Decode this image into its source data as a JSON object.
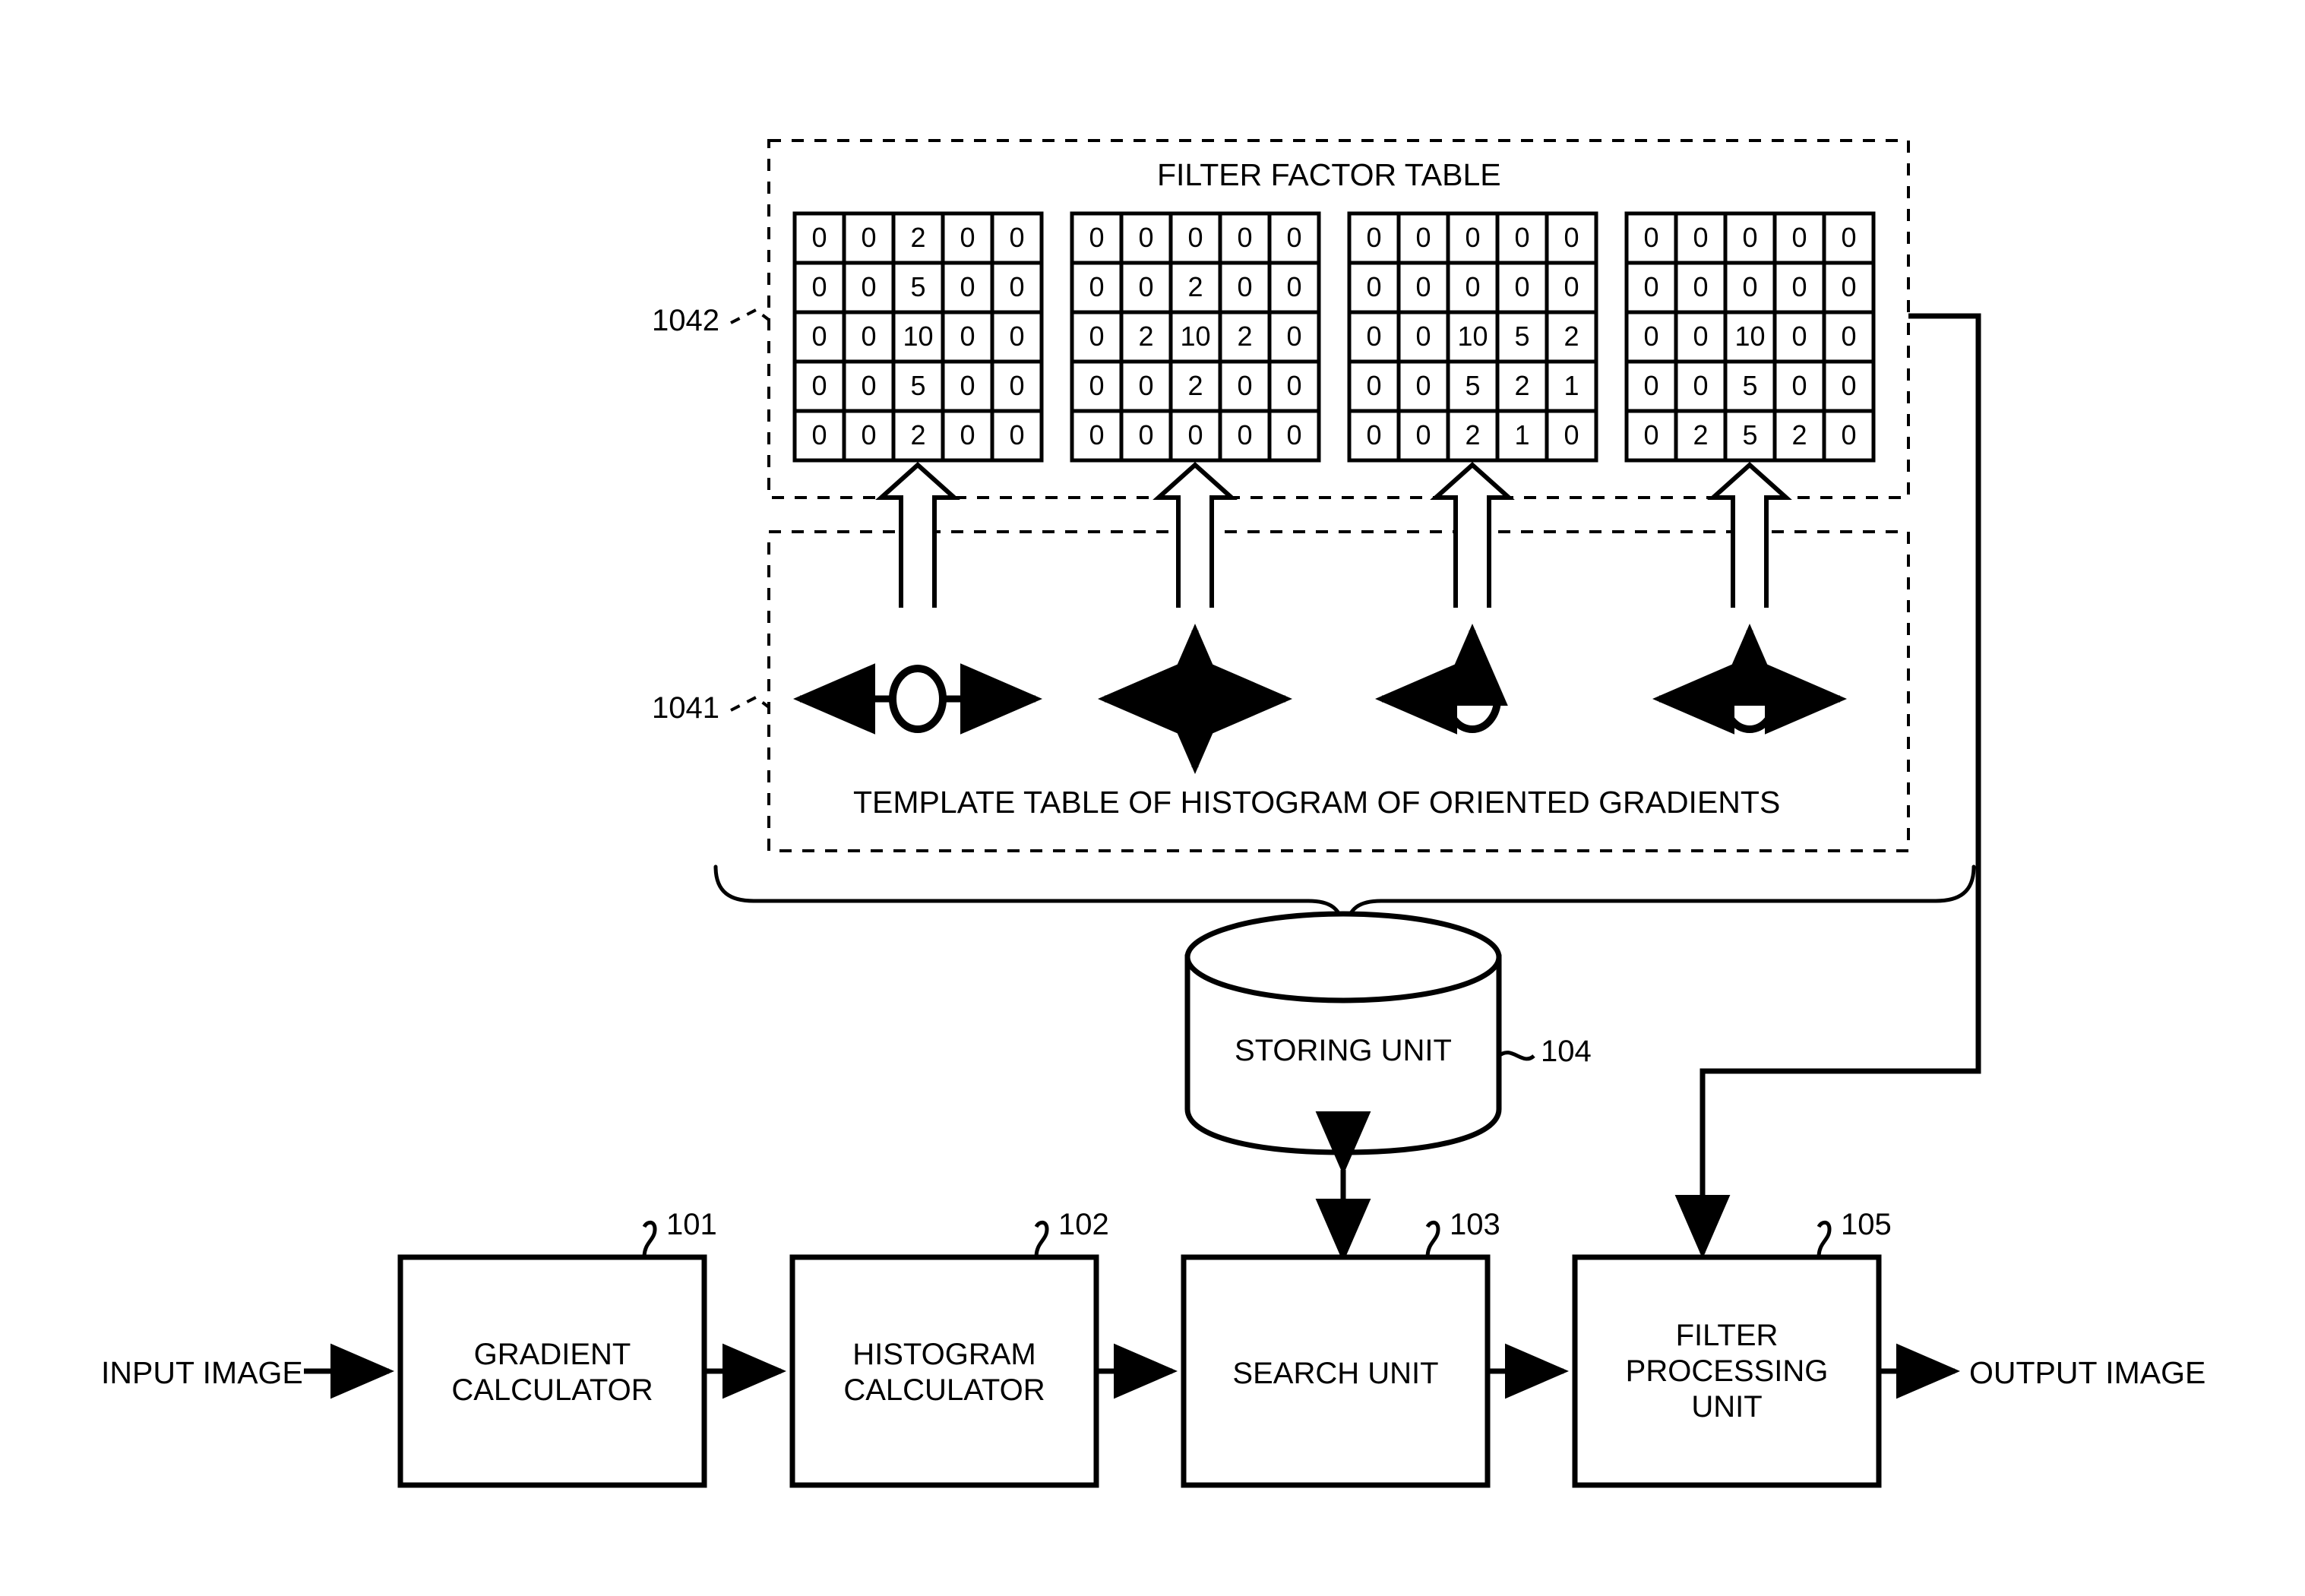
{
  "figure": {
    "filter_factor_table": {
      "title": "FILTER FACTOR TABLE",
      "ref": "1042",
      "matrices": [
        {
          "name": "matrix-1",
          "rows": [
            [
              "0",
              "0",
              "2",
              "0",
              "0"
            ],
            [
              "0",
              "0",
              "5",
              "0",
              "0"
            ],
            [
              "0",
              "0",
              "10",
              "0",
              "0"
            ],
            [
              "0",
              "0",
              "5",
              "0",
              "0"
            ],
            [
              "0",
              "0",
              "2",
              "0",
              "0"
            ]
          ]
        },
        {
          "name": "matrix-2",
          "rows": [
            [
              "0",
              "0",
              "0",
              "0",
              "0"
            ],
            [
              "0",
              "0",
              "2",
              "0",
              "0"
            ],
            [
              "0",
              "2",
              "10",
              "2",
              "0"
            ],
            [
              "0",
              "0",
              "2",
              "0",
              "0"
            ],
            [
              "0",
              "0",
              "0",
              "0",
              "0"
            ]
          ]
        },
        {
          "name": "matrix-3",
          "rows": [
            [
              "0",
              "0",
              "0",
              "0",
              "0"
            ],
            [
              "0",
              "0",
              "0",
              "0",
              "0"
            ],
            [
              "0",
              "0",
              "10",
              "5",
              "2"
            ],
            [
              "0",
              "0",
              "5",
              "2",
              "1"
            ],
            [
              "0",
              "0",
              "2",
              "1",
              "0"
            ]
          ]
        },
        {
          "name": "matrix-4",
          "rows": [
            [
              "0",
              "0",
              "0",
              "0",
              "0"
            ],
            [
              "0",
              "0",
              "0",
              "0",
              "0"
            ],
            [
              "0",
              "0",
              "10",
              "0",
              "0"
            ],
            [
              "0",
              "0",
              "5",
              "0",
              "0"
            ],
            [
              "0",
              "2",
              "5",
              "2",
              "0"
            ]
          ]
        }
      ]
    },
    "hog_template_table": {
      "title": "TEMPLATE TABLE OF HISTOGRAM OF ORIENTED GRADIENTS",
      "ref": "1041",
      "templates": [
        {
          "name": "gradient-symbol-horizontal",
          "directions": [
            "left",
            "right"
          ]
        },
        {
          "name": "gradient-symbol-cross",
          "directions": [
            "left",
            "right",
            "up",
            "down"
          ]
        },
        {
          "name": "gradient-symbol-corner-up-left",
          "directions": [
            "left",
            "up"
          ]
        },
        {
          "name": "gradient-symbol-tee-up",
          "directions": [
            "left",
            "right",
            "up"
          ]
        }
      ]
    },
    "storing_unit": {
      "label": "STORING UNIT",
      "ref": "104"
    },
    "pipeline": {
      "input_label": "INPUT IMAGE",
      "output_label": "OUTPUT IMAGE",
      "blocks": [
        {
          "name": "gradient-calculator",
          "lines": [
            "GRADIENT",
            "CALCULATOR"
          ],
          "ref": "101"
        },
        {
          "name": "histogram-calculator",
          "lines": [
            "HISTOGRAM",
            "CALCULATOR"
          ],
          "ref": "102"
        },
        {
          "name": "search-unit",
          "lines": [
            "SEARCH UNIT"
          ],
          "ref": "103"
        },
        {
          "name": "filter-processing-unit",
          "lines": [
            "FILTER",
            "PROCESSING",
            "UNIT"
          ],
          "ref": "105"
        }
      ]
    },
    "colors": {
      "line": "#000000",
      "background": "#ffffff"
    }
  }
}
